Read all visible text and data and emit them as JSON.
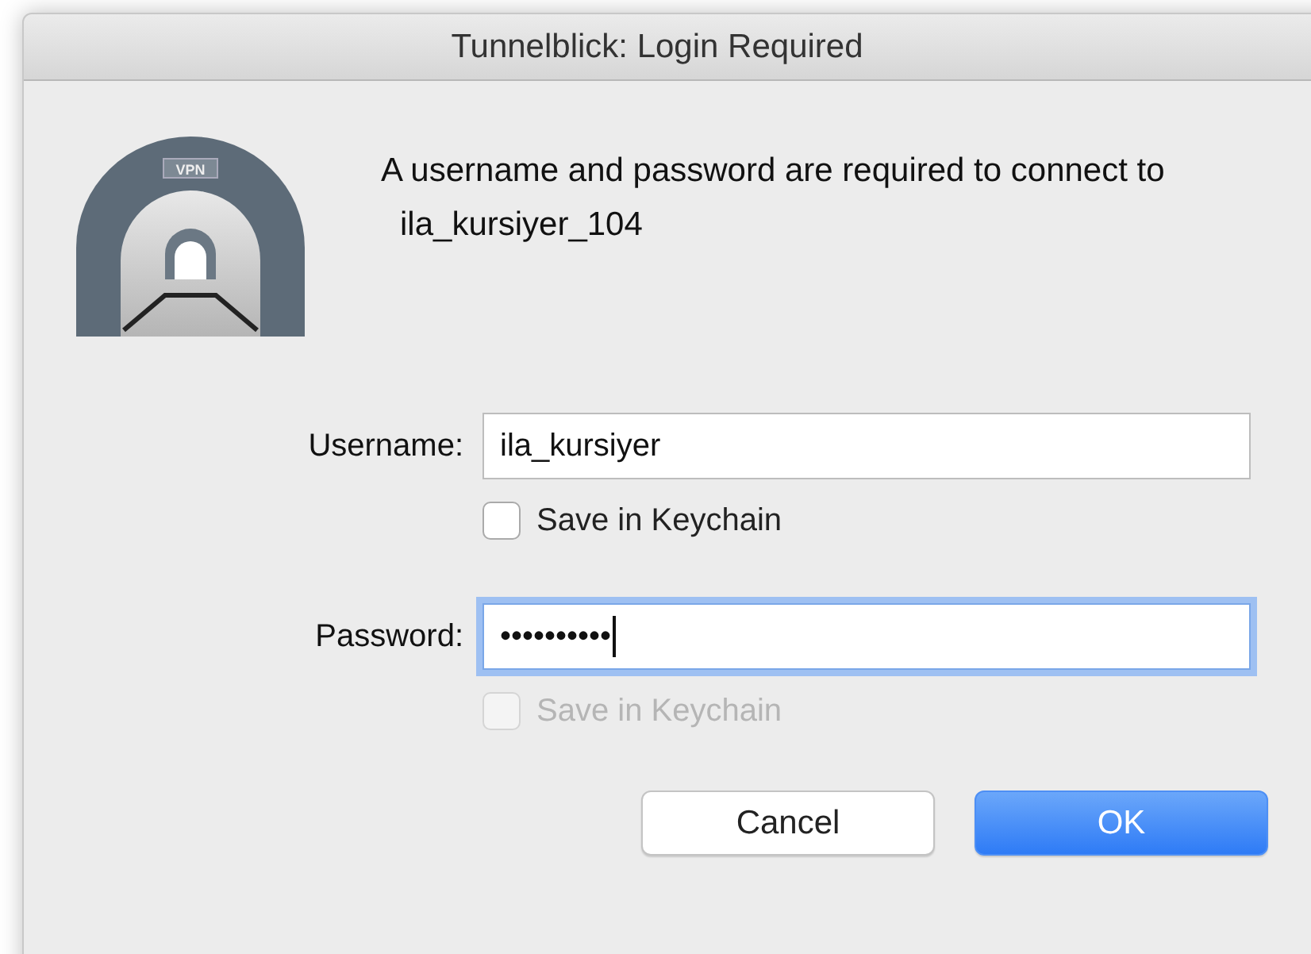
{
  "window": {
    "title": "Tunnelblick: Login Required"
  },
  "icon_label": "VPN",
  "message": {
    "text": "A username and password are required to connect to",
    "connection": "ila_kursiyer_104"
  },
  "fields": [
    {
      "label": "Username:",
      "value": "ila_kursiyer",
      "focused": false,
      "save": {
        "label": "Save in Keychain",
        "checked": false,
        "disabled": false
      }
    },
    {
      "label": "Password:",
      "value": "••••••••••",
      "focused": true,
      "save": {
        "label": "Save in Keychain",
        "checked": false,
        "disabled": true
      }
    }
  ],
  "buttons": [
    {
      "label": "Cancel",
      "kind": "normal"
    },
    {
      "label": "OK",
      "kind": "default"
    }
  ]
}
